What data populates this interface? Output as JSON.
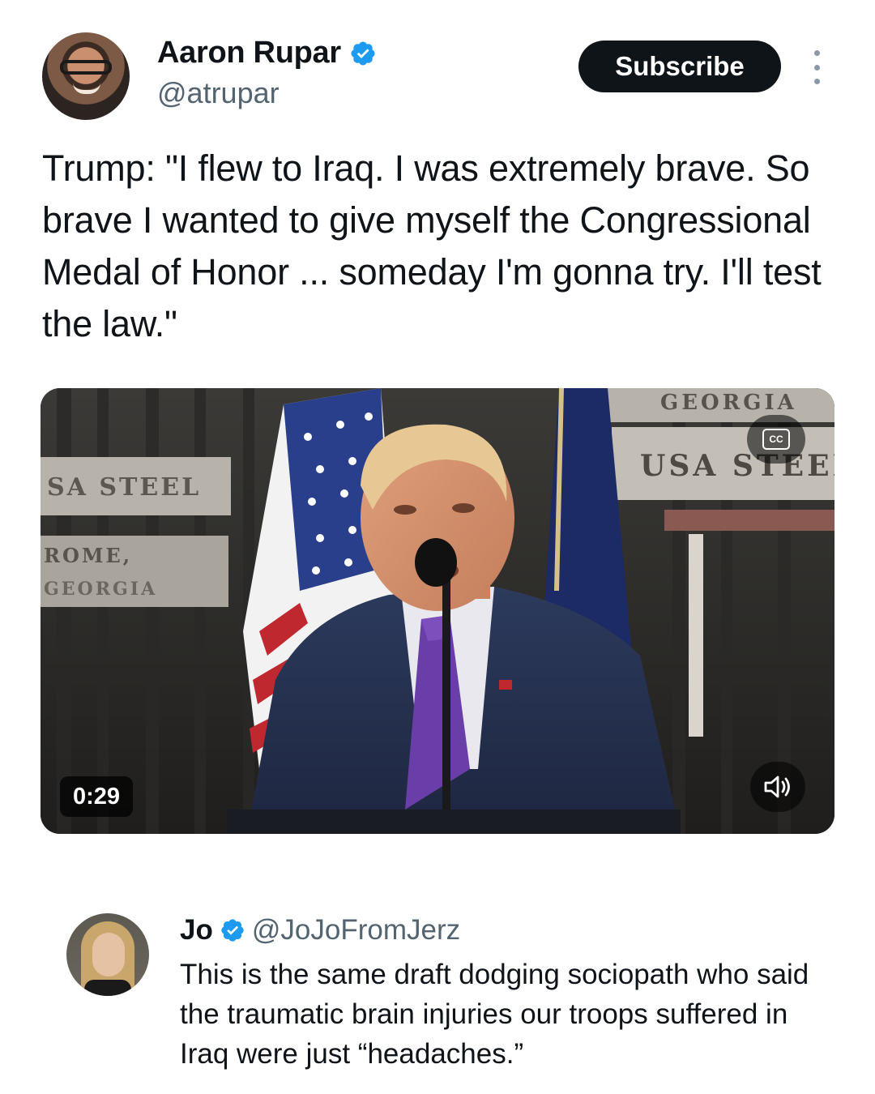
{
  "tweet": {
    "author_name": "Aaron Rupar",
    "author_handle": "@atrupar",
    "subscribe_label": "Subscribe",
    "text": "Trump: \"I flew to Iraq. I was extremely brave. So brave I wanted to give myself the Congressional Medal of Honor ... someday I'm gonna try. I'll test the law.\"",
    "video": {
      "duration": "0:29",
      "cc_label": "CC",
      "background_signs": [
        "GEORGIA",
        "USA STEEL",
        "SA STEEL",
        "ROME,",
        "GEORGIA"
      ]
    }
  },
  "reply": {
    "author_name": "Jo",
    "author_handle": "@JoJoFromJerz",
    "text": "This is the same draft dodging sociopath who said the traumatic brain injuries our troops suffered in Iraq were just “headaches.”"
  },
  "colors": {
    "verified_blue": "#1d9bf0",
    "text_primary": "#0f1419",
    "text_secondary": "#536471",
    "subscribe_bg": "#0f1419"
  },
  "icons": {
    "verified": "verified-badge-icon",
    "more": "more-options-icon",
    "cc": "closed-captions-icon",
    "sound": "volume-icon"
  }
}
